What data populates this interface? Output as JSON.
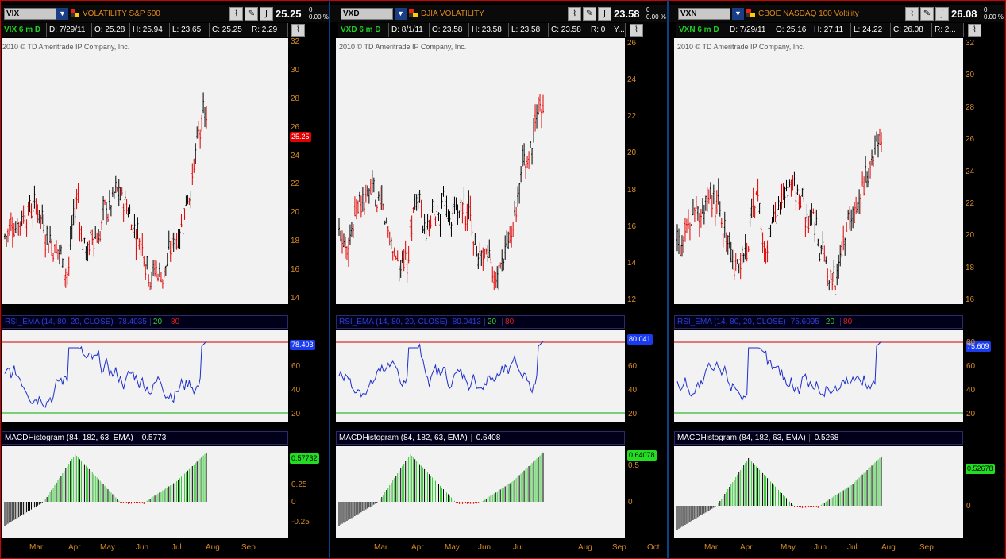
{
  "panes": [
    {
      "symbol": "VIX",
      "description": "VOLATILITY S&P 500",
      "price": "25.25",
      "change": "0",
      "change_pct": "0.00 %",
      "info": {
        "study": "VIX 6 m D",
        "date": "D: 7/29/11",
        "open": "O: 25.28",
        "high": "H: 25.94",
        "low": "L: 23.65",
        "close": "C: 25.25",
        "range": "R: 2.29"
      },
      "copyright": "2010 © TD Ameritrade IP Company, Inc.",
      "price_ticks": [
        "32",
        "30",
        "28",
        "26",
        "24",
        "22",
        "20",
        "18",
        "16",
        "14"
      ],
      "price_label": "25.25",
      "rsi_title": "RSI_EMA (14, 80, 20, CLOSE)",
      "rsi_value": "78.4035",
      "rsi_low": "20",
      "rsi_high": "80",
      "rsi_label": "78.403",
      "rsi_ticks": [
        "60",
        "40",
        "20"
      ],
      "macd_title": "MACDHistogram (84, 182, 63, EMA)",
      "macd_value": "0.5773",
      "macd_label": "0.57732",
      "macd_ticks": [
        "0.25",
        "0",
        "-0.25"
      ],
      "months": [
        "Mar",
        "Apr",
        "May",
        "Jun",
        "Jul",
        "Aug",
        "Sep"
      ]
    },
    {
      "symbol": "VXD",
      "description": "DJIA VOLATILITY",
      "price": "23.58",
      "change": "0",
      "change_pct": "0.00 %",
      "info": {
        "study": "VXD 6 m D",
        "date": "D: 8/1/11",
        "open": "O: 23.58",
        "high": "H: 23.58",
        "low": "L: 23.58",
        "close": "C: 23.58",
        "range": "R: 0",
        "extra": "Y..."
      },
      "copyright": "2010 © TD Ameritrade IP Company, Inc.",
      "price_ticks": [
        "26",
        "24",
        "22",
        "20",
        "18",
        "16",
        "14",
        "12"
      ],
      "price_label": "",
      "rsi_title": "RSI_EMA (14, 80, 20, CLOSE)",
      "rsi_value": "80.0413",
      "rsi_low": "20",
      "rsi_high": "80",
      "rsi_label": "80.041",
      "rsi_ticks": [
        "60",
        "40",
        "20"
      ],
      "macd_title": "MACDHistogram (84, 182, 63, EMA)",
      "macd_value": "0.6408",
      "macd_label": "0.64078",
      "macd_ticks": [
        "0.5",
        "0"
      ],
      "months": [
        "Mar",
        "Apr",
        "May",
        "Jun",
        "Jul",
        "Aug",
        "Sep",
        "Oct"
      ]
    },
    {
      "symbol": "VXN",
      "description": "CBOE NASDAQ 100 Voltility",
      "price": "26.08",
      "change": "0",
      "change_pct": "0.00 %",
      "info": {
        "study": "VXN 6 m D",
        "date": "D: 7/29/11",
        "open": "O: 25.16",
        "high": "H: 27.11",
        "low": "L: 24.22",
        "close": "C: 26.08",
        "range": "R: 2..."
      },
      "copyright": "2010 © TD Ameritrade IP Company, Inc.",
      "price_ticks": [
        "32",
        "30",
        "28",
        "26",
        "24",
        "22",
        "20",
        "18",
        "16"
      ],
      "price_label": "",
      "rsi_title": "RSI_EMA (14, 80, 20, CLOSE)",
      "rsi_value": "75.6095",
      "rsi_low": "20",
      "rsi_high": "80",
      "rsi_label": "75.609",
      "rsi_ticks": [
        "80",
        "60",
        "40",
        "20"
      ],
      "macd_title": "MACDHistogram (84, 182, 63, EMA)",
      "macd_value": "0.5268",
      "macd_label": "0.52678",
      "macd_ticks": [
        "0"
      ],
      "months": [
        "Mar",
        "Apr",
        "May",
        "Jun",
        "Jul",
        "Aug",
        "Sep"
      ]
    }
  ],
  "colors": {
    "up": "#000000",
    "down": "#e00000",
    "rsi": "#1f2fcc",
    "overbought": "#cc0000",
    "oversold": "#00aa00",
    "hist_pos": "#33cc33",
    "hist_neg": "#000000",
    "label_red": "#e00000",
    "label_blue": "#1a3cf0",
    "label_green": "#22dd22"
  },
  "icons": [
    "chart-style-icon",
    "drawing-pencil-icon",
    "studies-icon",
    "study-settings-icon"
  ]
}
